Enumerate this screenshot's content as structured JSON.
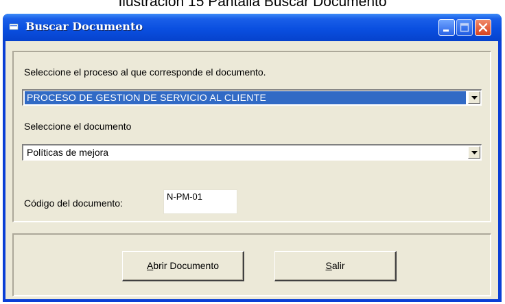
{
  "caption": "Ilustración 15 Pantalla Buscar Documento",
  "window": {
    "title": "Buscar Documento",
    "minimize_icon": "minimize-icon",
    "maximize_icon": "maximize-icon",
    "close_icon": "close-icon"
  },
  "form": {
    "process_label": "Seleccione el proceso al que corresponde el documento.",
    "process_selected": "PROCESO DE GESTION DE SERVICIO AL CLIENTE",
    "document_label": "Seleccione el documento",
    "document_selected": "Políticas de mejora",
    "code_label": "Código del documento:",
    "code_value": "N-PM-01"
  },
  "buttons": {
    "open_accel": "A",
    "open_rest": "brir Documento",
    "exit_accel": "S",
    "exit_rest": "alir"
  },
  "colors": {
    "titlebar": "#0a4fe0",
    "selection": "#316ac5",
    "face": "#ece9d8"
  }
}
